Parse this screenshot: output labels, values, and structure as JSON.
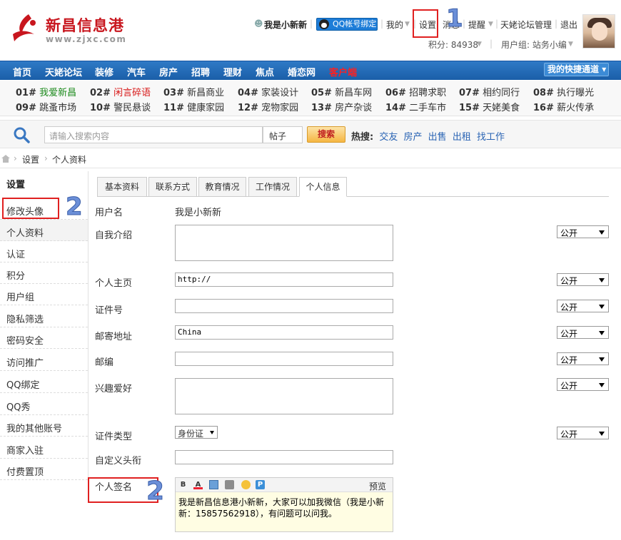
{
  "header": {
    "site_name": "新昌信息港",
    "site_url": "www.zjxc.com",
    "username": "我是小新新",
    "qq_bind": "QQ帐号绑定",
    "mine": "我的",
    "settings": "设置",
    "messages": "消息",
    "remind": "提醒",
    "forum_admin": "天姥论坛管理",
    "logout": "退出",
    "points": "积分: 84938",
    "usergroup": "用户组: 站务小编"
  },
  "nav": {
    "items": [
      "首页",
      "天姥论坛",
      "装修",
      "汽车",
      "房产",
      "招聘",
      "理财",
      "焦点",
      "婚恋网",
      "客户端"
    ],
    "quick": "我的快捷通道"
  },
  "links": [
    {
      "num": "01#",
      "label": "我爱新昌"
    },
    {
      "num": "02#",
      "label": "闲言碎语"
    },
    {
      "num": "03#",
      "label": "新昌商业"
    },
    {
      "num": "04#",
      "label": "家装设计"
    },
    {
      "num": "05#",
      "label": "新昌车网"
    },
    {
      "num": "06#",
      "label": "招聘求职"
    },
    {
      "num": "07#",
      "label": "相约同行"
    },
    {
      "num": "08#",
      "label": "执行曝光"
    },
    {
      "num": "09#",
      "label": "跳蚤市场"
    },
    {
      "num": "10#",
      "label": "警民悬谈"
    },
    {
      "num": "11#",
      "label": "健康家园"
    },
    {
      "num": "12#",
      "label": "宠物家园"
    },
    {
      "num": "13#",
      "label": "房产杂谈"
    },
    {
      "num": "14#",
      "label": "二手车市"
    },
    {
      "num": "15#",
      "label": "天姥美食"
    },
    {
      "num": "16#",
      "label": "薪火传承"
    }
  ],
  "search": {
    "placeholder": "请输入搜索内容",
    "type": "帖子",
    "button": "搜索",
    "hot_label": "热搜:",
    "hot": [
      "交友",
      "房产",
      "出售",
      "出租",
      "找工作"
    ]
  },
  "breadcrumb": {
    "a": "设置",
    "b": "个人资料"
  },
  "sidebar": {
    "title": "设置",
    "items": [
      "修改头像",
      "个人资料",
      "认证",
      "积分",
      "用户组",
      "隐私筛选",
      "密码安全",
      "访问推广",
      "QQ绑定",
      "QQ秀",
      "我的其他账号",
      "商家入驻",
      "付费置顶"
    ]
  },
  "tabs": [
    "基本资料",
    "联系方式",
    "教育情况",
    "工作情况",
    "个人信息"
  ],
  "form": {
    "username_label": "用户名",
    "username_value": "我是小新新",
    "intro_label": "自我介绍",
    "homepage_label": "个人主页",
    "homepage_value": "http://",
    "idnum_label": "证件号",
    "address_label": "邮寄地址",
    "address_value": "China",
    "zip_label": "邮编",
    "hobby_label": "兴趣爱好",
    "idtype_label": "证件类型",
    "idtype_value": "身份证",
    "custom_label": "自定义头衔",
    "sign_label": "个人签名",
    "sign_value": "我是新昌信息港小新新，大家可以加我微信（我是小新新：15857562918），有问题可以问我。",
    "preview": "预览",
    "privacy": "公开"
  },
  "annotations": {
    "one": "1",
    "two_a": "2",
    "two_b": "2"
  },
  "colors": {
    "nav": "#1a5ea8",
    "brand_red": "#c8161e",
    "highlight": "#e02020"
  }
}
